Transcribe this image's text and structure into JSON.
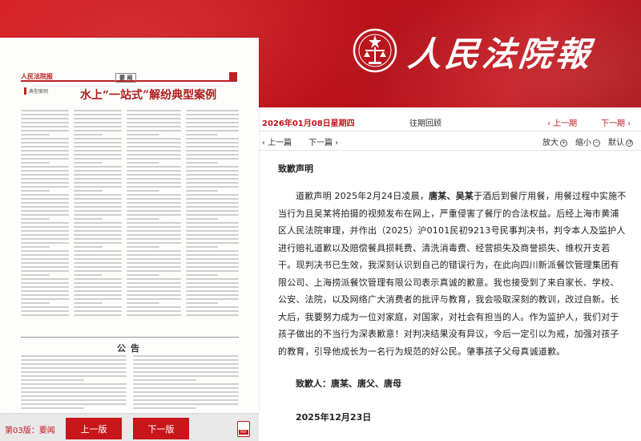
{
  "banner": {
    "masthead": "人民法院報",
    "colors": {
      "red": "#c8161b",
      "dark_red": "#a9111a"
    }
  },
  "thumbnail": {
    "logo": "人民法院报",
    "section": "要 闻",
    "headline": "水上“一站式”解纷典型案例",
    "notice_title": "公告"
  },
  "pager": {
    "page_label": "第03版：要闻",
    "prev_button": "上一版",
    "next_button": "下一版",
    "pdf_icon": "pdf-icon"
  },
  "datebar": {
    "date": "2026年01月08日星期四",
    "archive": "往期回顾",
    "prev_page": "‹ 上一期",
    "next_page": "下一期 ›"
  },
  "toolbar": {
    "prev_article": "‹ 上一篇",
    "next_article": "下一篇 ›",
    "zoom_in": "放大",
    "zoom_out": "缩小",
    "default": "默认"
  },
  "article": {
    "title": "致歉声明",
    "body_parts": [
      "道歉声明 2025年2月24日凌晨，",
      "唐某、吴某",
      "于酒后到餐厅用餐，用餐过程中实施不当行为且吴某将拍摄的视频发布在网上，严重侵害了餐厅的合法权益。后经上海市黄浦区人民法院审理，并作出（2025）沪0101民初9213号民事判决书，判令本人及监护人进行赔礼道歉以及赔偿餐具损耗费、清洗消毒费、经营损失及商誉损失、维权开支若干。现判决书已生效，我深刻认识到自己的错误行为，在此向四川新派餐饮管理集团有限公司、上海捞派餐饮管理有限公司表示真诚的歉意。我也接受到了来自家长、学校、公安、法院，以及网络广大消费者的批评与教育，我会吸取深刻的教训，改过自新。长大后，我要努力成为一位对家庭，对国家，对社会有担当的人。作为监护人，我们对于孩子做出的不当行为深表歉意！对判决结果没有异议，今后一定引以为戒，加强对孩子的教育，引导他成长为一名行为规范的好公民。肇事孩子父母真诚道歉。"
    ],
    "signer": "致歉人：唐某、唐父、唐母",
    "date": "2025年12月23日"
  }
}
